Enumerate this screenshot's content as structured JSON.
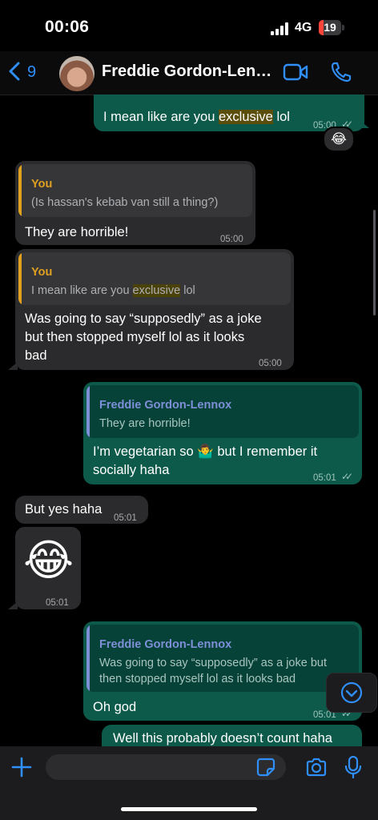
{
  "status": {
    "time": "00:06",
    "network": "4G",
    "battery": "19"
  },
  "header": {
    "back_count": "9",
    "contact_name": "Freddie Gordon-Lenn..."
  },
  "messages": {
    "m1": {
      "text_before": "I mean like are you ",
      "highlight": "exclusive",
      "text_after": " lol",
      "time": "05:00",
      "reaction": "😂"
    },
    "m2": {
      "quote_name": "You",
      "quote_text": "(Is hassan's kebab van still a thing?)",
      "text": "They are horrible!",
      "time": "05:00"
    },
    "m3": {
      "quote_name": "You",
      "quote_before": "I mean like are you ",
      "quote_highlight": "exclusive",
      "quote_after": " lol",
      "line1": "Was going to say “supposedly” as a joke",
      "line2": "but then stopped myself lol as it looks",
      "line3": "bad",
      "time": "05:00"
    },
    "m4": {
      "quote_name": "Freddie Gordon-Lennox",
      "quote_text": "They are horrible!",
      "line1_before": "I’m vegetarian so ",
      "emoji": "🤷‍♂️",
      "line1_after": " but I remember it",
      "line2": "socially haha",
      "time": "05:01"
    },
    "m5": {
      "text": "But yes haha",
      "time": "05:01"
    },
    "m6": {
      "emoji": "😂",
      "time": "05:01"
    },
    "m7": {
      "quote_name": "Freddie Gordon-Lennox",
      "quote_line1": "Was going to say “supposedly” as a joke but",
      "quote_line2": "then stopped myself lol as it looks bad",
      "text": "Oh god",
      "time": "05:01"
    },
    "m8": {
      "text": "Well this probably doesn’t count haha"
    }
  },
  "composer": {
    "placeholder": ""
  },
  "colors": {
    "accent": "#2f8ef7",
    "outgoing": "#0d5a4b",
    "incoming": "#2b2b2d",
    "quote_you": "#e0a020",
    "quote_contact": "#7e8fd8"
  }
}
